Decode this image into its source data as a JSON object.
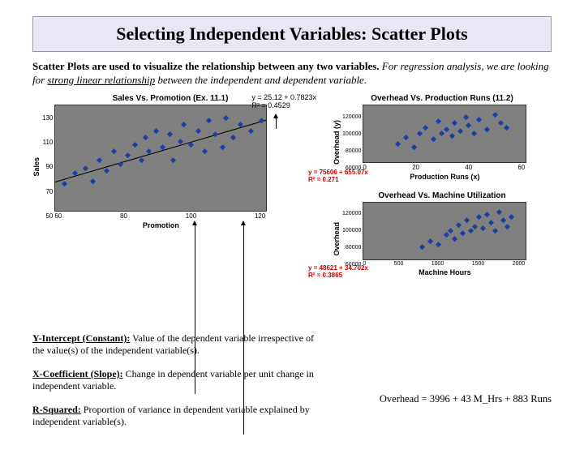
{
  "title": "Selecting Independent Variables: Scatter Plots",
  "intro": {
    "lead_bold": "Scatter Plots are used to visualize the relationship between any two variables.",
    "rest1": " For regression analysis, we are looking for ",
    "emph": "strong linear relationship",
    "rest2": " between the independent and dependent variable."
  },
  "chart_data": [
    {
      "type": "scatter",
      "title": "Sales Vs. Promotion (Ex. 11.1)",
      "xlabel": "Promotion",
      "ylabel": "Sales",
      "xlim": [
        60,
        120
      ],
      "ylim": [
        50,
        130
      ],
      "yticks": [
        50,
        70,
        90,
        110,
        130
      ],
      "xticks": [
        60,
        80,
        100,
        120
      ],
      "trendline": {
        "slope": 0.7823,
        "intercept": 25.12
      },
      "equation": "y = 25.12 + 0.7823x",
      "r2": "R² = 0.4529",
      "points": [
        {
          "x": 62,
          "y": 70
        },
        {
          "x": 65,
          "y": 78
        },
        {
          "x": 68,
          "y": 82
        },
        {
          "x": 70,
          "y": 72
        },
        {
          "x": 72,
          "y": 88
        },
        {
          "x": 74,
          "y": 80
        },
        {
          "x": 76,
          "y": 95
        },
        {
          "x": 78,
          "y": 85
        },
        {
          "x": 80,
          "y": 92
        },
        {
          "x": 82,
          "y": 100
        },
        {
          "x": 84,
          "y": 88
        },
        {
          "x": 85,
          "y": 105
        },
        {
          "x": 86,
          "y": 95
        },
        {
          "x": 88,
          "y": 110
        },
        {
          "x": 90,
          "y": 98
        },
        {
          "x": 92,
          "y": 108
        },
        {
          "x": 93,
          "y": 88
        },
        {
          "x": 95,
          "y": 102
        },
        {
          "x": 96,
          "y": 115
        },
        {
          "x": 98,
          "y": 100
        },
        {
          "x": 100,
          "y": 110
        },
        {
          "x": 102,
          "y": 95
        },
        {
          "x": 103,
          "y": 118
        },
        {
          "x": 105,
          "y": 108
        },
        {
          "x": 107,
          "y": 98
        },
        {
          "x": 108,
          "y": 120
        },
        {
          "x": 110,
          "y": 105
        },
        {
          "x": 112,
          "y": 115
        },
        {
          "x": 115,
          "y": 110
        },
        {
          "x": 118,
          "y": 118
        }
      ]
    },
    {
      "type": "scatter",
      "title": "Overhead Vs. Production Runs (11.2)",
      "xlabel": "Production Runs (x)",
      "ylabel": "Overhead (y)",
      "xlim": [
        0,
        60
      ],
      "ylim": [
        60000,
        130000
      ],
      "yticks": [
        60000,
        80000,
        100000,
        120000
      ],
      "xticks": [
        0,
        20,
        40,
        60
      ],
      "equation": "y = 75606 + 655.07x",
      "r2": "R² = 0.271",
      "points": [
        {
          "x": 12,
          "y": 82000
        },
        {
          "x": 15,
          "y": 90000
        },
        {
          "x": 18,
          "y": 78000
        },
        {
          "x": 20,
          "y": 95000
        },
        {
          "x": 22,
          "y": 102000
        },
        {
          "x": 25,
          "y": 88000
        },
        {
          "x": 27,
          "y": 110000
        },
        {
          "x": 28,
          "y": 95000
        },
        {
          "x": 30,
          "y": 100000
        },
        {
          "x": 32,
          "y": 92000
        },
        {
          "x": 33,
          "y": 108000
        },
        {
          "x": 35,
          "y": 98000
        },
        {
          "x": 37,
          "y": 115000
        },
        {
          "x": 38,
          "y": 105000
        },
        {
          "x": 40,
          "y": 95000
        },
        {
          "x": 42,
          "y": 112000
        },
        {
          "x": 45,
          "y": 100000
        },
        {
          "x": 48,
          "y": 118000
        },
        {
          "x": 50,
          "y": 108000
        },
        {
          "x": 52,
          "y": 102000
        }
      ]
    },
    {
      "type": "scatter",
      "title": "Overhead Vs. Machine Utilization",
      "xlabel": "Machine Hours",
      "ylabel": "Overhead",
      "xlim": [
        0,
        2000
      ],
      "ylim": [
        60000,
        130000
      ],
      "yticks": [
        60000,
        80000,
        100000,
        120000
      ],
      "xticks": [
        0,
        500,
        1000,
        1500,
        2000
      ],
      "equation": "y = 48621 + 34.702x",
      "r2": "R² = 0.3865",
      "points": [
        {
          "x": 700,
          "y": 75000
        },
        {
          "x": 800,
          "y": 82000
        },
        {
          "x": 900,
          "y": 78000
        },
        {
          "x": 1000,
          "y": 90000
        },
        {
          "x": 1050,
          "y": 95000
        },
        {
          "x": 1100,
          "y": 85000
        },
        {
          "x": 1150,
          "y": 102000
        },
        {
          "x": 1200,
          "y": 92000
        },
        {
          "x": 1250,
          "y": 108000
        },
        {
          "x": 1300,
          "y": 95000
        },
        {
          "x": 1350,
          "y": 100000
        },
        {
          "x": 1400,
          "y": 112000
        },
        {
          "x": 1450,
          "y": 98000
        },
        {
          "x": 1500,
          "y": 115000
        },
        {
          "x": 1550,
          "y": 105000
        },
        {
          "x": 1600,
          "y": 95000
        },
        {
          "x": 1650,
          "y": 118000
        },
        {
          "x": 1700,
          "y": 108000
        },
        {
          "x": 1750,
          "y": 100000
        },
        {
          "x": 1800,
          "y": 112000
        }
      ]
    }
  ],
  "defs": {
    "yint_head": "Y-Intercept (Constant):",
    "yint_body": " Value of the dependent variable irrespective of the value(s) of the independent variable(s).",
    "xcoef_head": "X-Coefficient (Slope):",
    "xcoef_body": " Change in dependent variable per unit change in independent variable.",
    "r2_head": "R-Squared:",
    "r2_body": " Proportion of variance in dependent variable explained by independent variable(s)."
  },
  "overhead_eq": "Overhead = 3996 + 43 M_Hrs + 883 Runs"
}
